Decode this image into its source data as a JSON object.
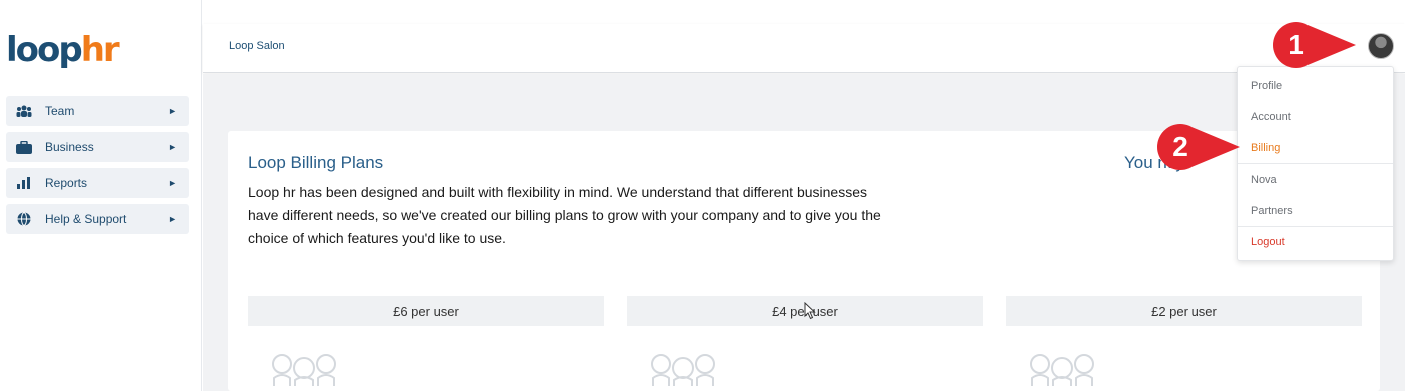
{
  "logo": {
    "part1": "loop",
    "part2": "hr"
  },
  "sidebar": {
    "items": [
      {
        "label": "Team",
        "icon": "team-icon"
      },
      {
        "label": "Business",
        "icon": "briefcase-icon"
      },
      {
        "label": "Reports",
        "icon": "bar-chart-icon"
      },
      {
        "label": "Help & Support",
        "icon": "globe-icon"
      }
    ]
  },
  "header": {
    "title": "Loop Salon"
  },
  "card": {
    "title": "Loop Billing Plans",
    "title_right": "You         ntly",
    "description": "Loop hr has been designed and built with flexibility in mind. We understand that different businesses have different needs, so we've created our billing plans to grow with your company and to give you the choice of which features you'd like to use."
  },
  "plans": [
    {
      "price": "£6 per user"
    },
    {
      "price": "£4 per user"
    },
    {
      "price": "£2 per user"
    }
  ],
  "user_menu": {
    "items": [
      "Profile",
      "Account",
      "Billing",
      "Nova",
      "Partners",
      "Logout"
    ],
    "active": "Billing"
  },
  "markers": [
    "1",
    "2"
  ],
  "colors": {
    "brand_blue": "#1d4e73",
    "brand_orange": "#f07b1a",
    "marker_red": "#e3262f",
    "logout_red": "#d83a2b"
  }
}
